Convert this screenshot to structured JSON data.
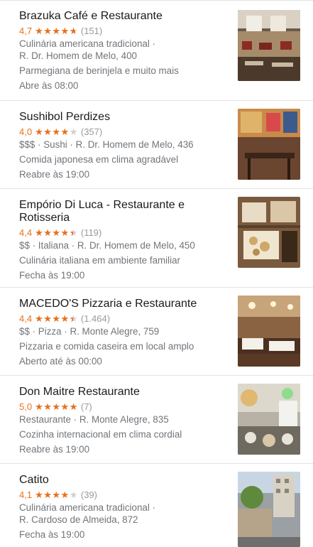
{
  "results": [
    {
      "name": "Brazuka Café e Restaurante",
      "rating": "4,7",
      "rating_value": 4.7,
      "reviews": "(151)",
      "lines": [
        "Culinária americana tradicional ·",
        "R. Dr. Homem de Melo, 400"
      ],
      "description": "Parmegiana de berinjela e muito mais",
      "hours": "Abre às 08:00"
    },
    {
      "name": "Sushibol Perdizes",
      "rating": "4,0",
      "rating_value": 4.0,
      "reviews": "(357)",
      "lines": [
        "$$$ · Sushi · R. Dr. Homem de Melo, 436"
      ],
      "description": "Comida japonesa em clima agradável",
      "hours": "Reabre às 19:00"
    },
    {
      "name": "Empório Di Luca - Restaurante e Rotisseria",
      "rating": "4,4",
      "rating_value": 4.4,
      "reviews": "(119)",
      "lines": [
        "$$ · Italiana · R. Dr. Homem de Melo, 450"
      ],
      "description": "Culinária italiana em ambiente familiar",
      "hours": "Fecha às 19:00"
    },
    {
      "name": "MACEDO'S Pizzaria e Restaurante",
      "rating": "4,4",
      "rating_value": 4.4,
      "reviews": "(1.464)",
      "lines": [
        "$$ · Pizza · R. Monte Alegre, 759"
      ],
      "description": "Pizzaria e comida caseira em local amplo",
      "hours": "Aberto até às 00:00"
    },
    {
      "name": "Don Maitre Restaurante",
      "rating": "5,0",
      "rating_value": 5.0,
      "reviews": "(7)",
      "lines": [
        "Restaurante · R. Monte Alegre, 835"
      ],
      "description": "Cozinha internacional em clima cordial",
      "hours": "Reabre às 19:00"
    },
    {
      "name": "Catito",
      "rating": "4,1",
      "rating_value": 4.1,
      "reviews": "(39)",
      "lines": [
        "Culinária americana tradicional ·",
        "R. Cardoso de Almeida, 872"
      ],
      "description": "",
      "hours": "Fecha às 19:00"
    }
  ],
  "colors": {
    "accent": "#e7711b",
    "star_empty": "#d0d0d0",
    "secondary_text": "#70757a",
    "divider": "#e3e3e3"
  }
}
